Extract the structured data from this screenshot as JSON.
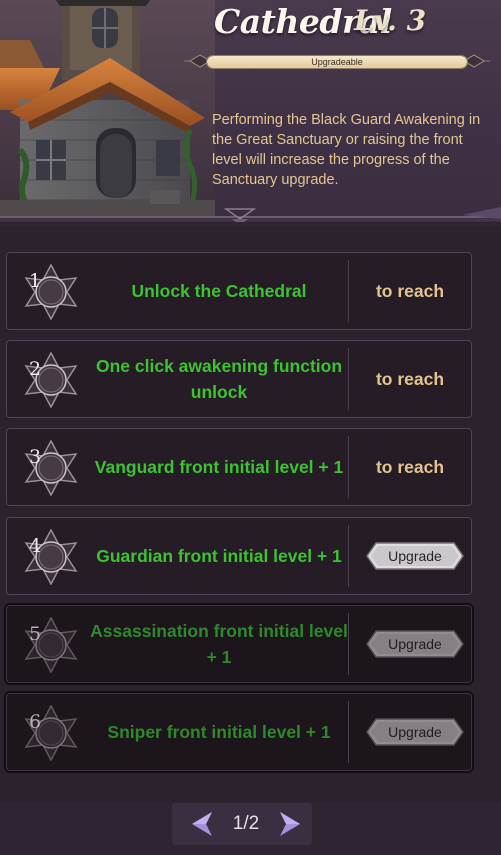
{
  "header": {
    "title": "Cathedral",
    "level": "Lv. 3",
    "progress_label": "Upgradeable",
    "progress": 1.0,
    "description": "Performing the Black Guard Awakening in the Great Sanctuary or raising the front level will increase the progress of the Sanctuary upgrade."
  },
  "items": [
    {
      "number": "1",
      "label": "Unlock the Cathedral",
      "status": "to reach",
      "locked": false
    },
    {
      "number": "2",
      "label": "One click awakening function unlock",
      "status": "to reach",
      "locked": false
    },
    {
      "number": "3",
      "label": "Vanguard front initial level + 1",
      "status": "to reach",
      "locked": false
    },
    {
      "number": "4",
      "label": "Guardian front initial level + 1",
      "button": "Upgrade",
      "locked": false
    },
    {
      "number": "5",
      "label": "Assassination front initial level + 1",
      "button": "Upgrade",
      "locked": true
    },
    {
      "number": "6",
      "label": "Sniper front initial level + 1",
      "button": "Upgrade",
      "locked": true
    }
  ],
  "pagination": {
    "page": "1/2",
    "prev_icon": "arrow-left-icon",
    "next_icon": "arrow-right-icon"
  },
  "colors": {
    "green_text": "#3bc42f",
    "gold_text": "#e2c48c",
    "arrow": "#a78fe0"
  }
}
